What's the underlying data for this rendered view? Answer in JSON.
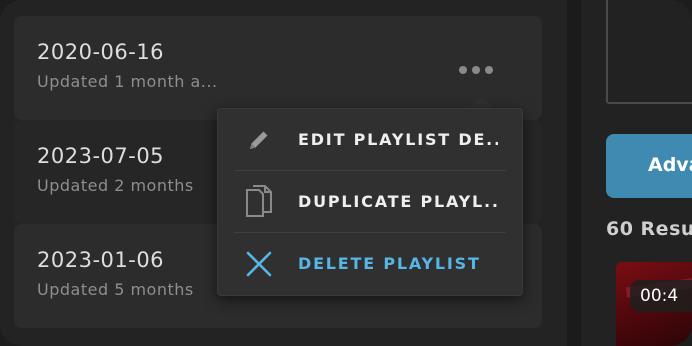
{
  "playlists": [
    {
      "date": "2020-06-16",
      "updated": "Updated 1 month a..."
    },
    {
      "date": "2023-07-05",
      "updated": "Updated 2 months"
    },
    {
      "date": "2023-01-06",
      "updated": "Updated 5 months"
    }
  ],
  "context_menu": {
    "items": [
      {
        "label": "EDIT PLAYLIST DE...",
        "icon": "pencil-icon"
      },
      {
        "label": "DUPLICATE PLAYL...",
        "icon": "copy-icon"
      },
      {
        "label": "DELETE PLAYLIST",
        "icon": "close-icon"
      }
    ]
  },
  "right_panel": {
    "advanced_button": "Adva",
    "results": "60 Resu",
    "thumbnail_duration": "00:4"
  },
  "colors": {
    "accent_blue": "#56b6e6",
    "button_blue": "#3f8ab0"
  }
}
